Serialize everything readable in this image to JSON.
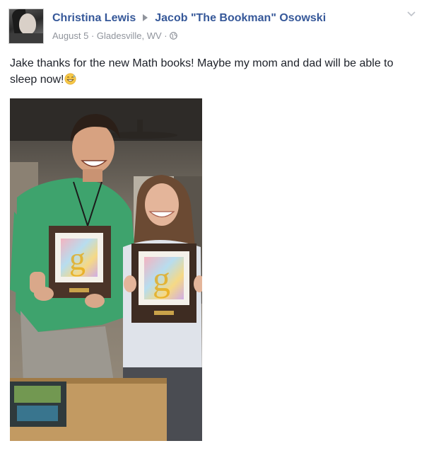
{
  "post": {
    "author": "Christina Lewis",
    "recipient": "Jacob \"The Bookman\" Osowski",
    "date": "August 5",
    "location": "Gladesville, WV",
    "text": "Jake thanks for the new Math books! Maybe my mom and dad will be able to sleep now!"
  },
  "icons": {
    "share_arrow": "triangle-right-icon",
    "privacy": "globe-icon",
    "menu": "chevron-down-icon",
    "emoji": "grinning-sweat-emoji-icon"
  },
  "colors": {
    "link": "#365899",
    "meta": "#90949c",
    "text": "#1d2129"
  }
}
